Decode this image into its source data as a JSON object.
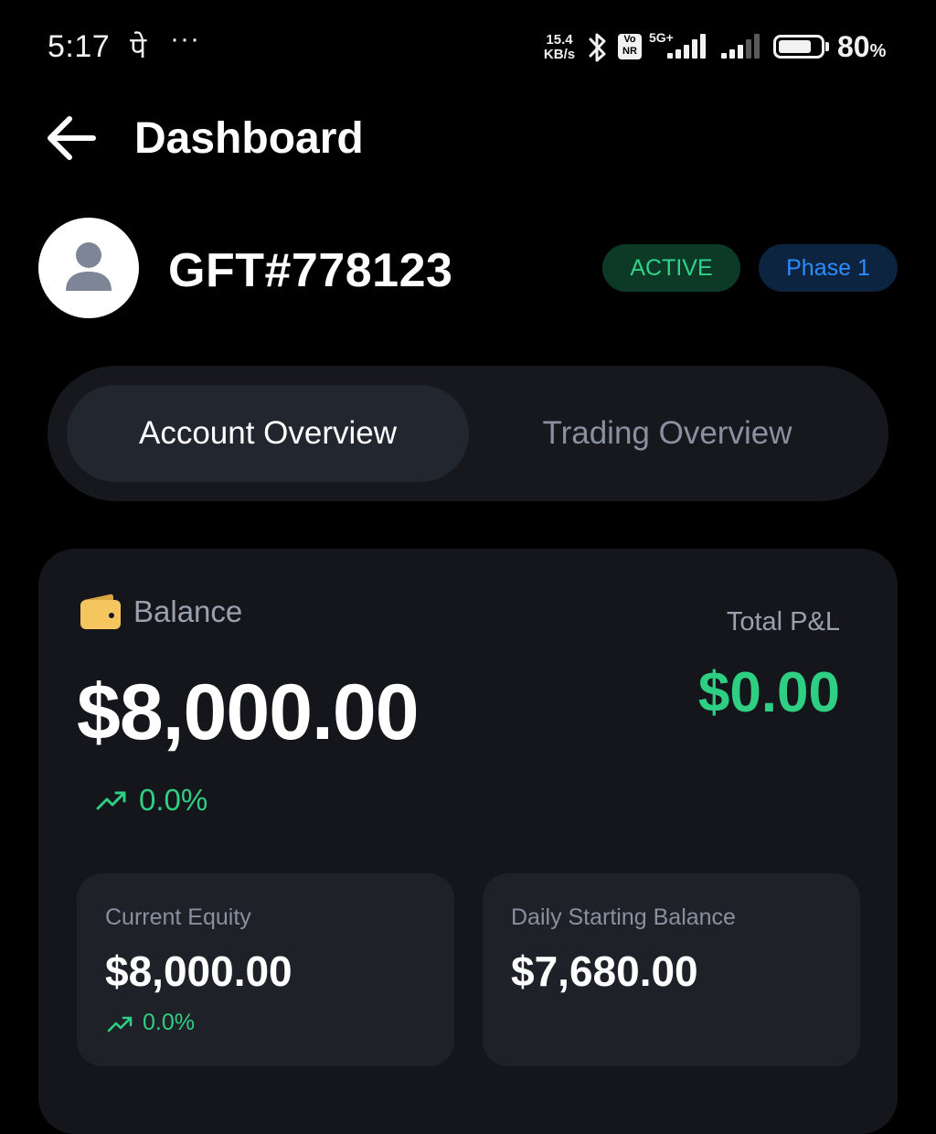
{
  "status_bar": {
    "time": "5:17",
    "app_glyph": "पे",
    "more": "···",
    "net_speed_value": "15.4",
    "net_speed_unit": "KB/s",
    "vonr": "Vo NR",
    "network": "5G+",
    "battery_percent": "80",
    "battery_percent_sign": "%",
    "battery_level": 0.8,
    "icons": [
      "bluetooth-icon",
      "signal-icon",
      "battery-icon"
    ]
  },
  "header": {
    "back_icon": "arrow-left-icon",
    "title": "Dashboard"
  },
  "profile": {
    "avatar_icon": "user-icon",
    "account_id": "GFT#778123",
    "status_badge": "ACTIVE",
    "phase_badge": "Phase 1"
  },
  "tabs": [
    {
      "label": "Account Overview",
      "selected": true
    },
    {
      "label": "Trading Overview",
      "selected": false
    }
  ],
  "balance_card": {
    "icon": "wallet-icon",
    "label": "Balance",
    "value": "$8,000.00",
    "change_icon": "trending-up-icon",
    "change": "0.0%",
    "pnl_label": "Total P&L",
    "pnl_value": "$0.00"
  },
  "stats": [
    {
      "label": "Current Equity",
      "value": "$8,000.00",
      "change": "0.0%"
    },
    {
      "label": "Daily Starting Balance",
      "value": "$7,680.00"
    }
  ],
  "colors": {
    "background": "#000000",
    "card": "#14161b",
    "positive": "#2fcf83",
    "active_badge_bg": "#0d3a26",
    "phase_badge_text": "#2d8cff",
    "wallet": "#f5c660"
  }
}
